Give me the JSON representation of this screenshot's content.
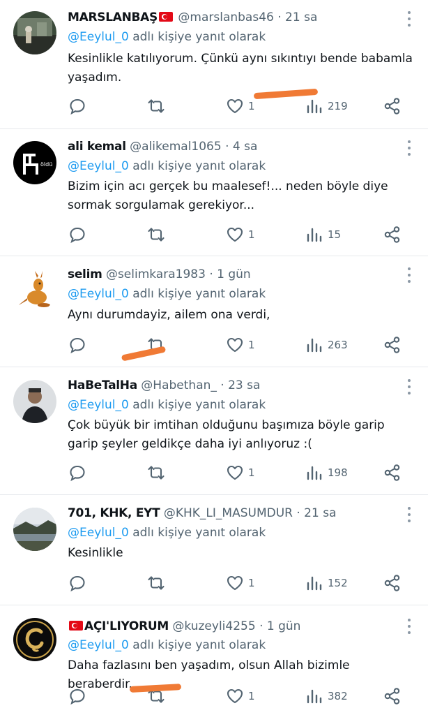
{
  "reply_prefix": "@Eeylul_0",
  "reply_suffix": "adlı kişiye yanıt olarak",
  "tweets": [
    {
      "name": "MARSLANBAŞ",
      "flag_after": true,
      "flag_before": false,
      "handle": "@marslanbas46",
      "time": "21 sa",
      "text": "Kesinlikle katılıyorum. Çünkü aynı sıkıntıyı bende babamla yaşadım.",
      "likes": "1",
      "views": "219",
      "avatar_icon": "landscape-photo-avatar"
    },
    {
      "name": "ali kemal",
      "flag_after": false,
      "flag_before": false,
      "handle": "@alikemal1065",
      "time": "4 sa",
      "text": "Bizim için acı gerçek bu maalesef!... neden böyle diye sormak sorgulamak gerekiyor...",
      "likes": "1",
      "views": "15",
      "avatar_icon": "chair-logo-avatar"
    },
    {
      "name": "selim",
      "flag_after": false,
      "flag_before": false,
      "handle": "@selimkara1983",
      "time": "1 gün",
      "text": "Aynı durumdayiz, ailem ona verdi,",
      "likes": "1",
      "views": "263",
      "avatar_icon": "kangaroo-avatar"
    },
    {
      "name": "HaBeTalHa",
      "flag_after": false,
      "flag_before": false,
      "handle": "@Habethan_",
      "time": "23 sa",
      "text": "Çok büyük bir imtihan olduğunu başımıza böyle garip garip şeyler geldikçe daha iyi anlıyoruz :(",
      "likes": "1",
      "views": "198",
      "avatar_icon": "person-photo-avatar"
    },
    {
      "name": "701, KHK, EYT",
      "flag_after": false,
      "flag_before": false,
      "handle": "@KHK_LI_MASUMDUR",
      "time": "21 sa",
      "text": "Kesinlikle",
      "likes": "1",
      "views": "152",
      "avatar_icon": "river-photo-avatar"
    },
    {
      "name": "AÇI'LIYORUM",
      "flag_after": false,
      "flag_before": true,
      "handle": "@kuzeyli4255",
      "time": "1 gün",
      "text": "Daha fazlasını ben yaşadım, olsun Allah bizimle beraberdir.",
      "likes": "1",
      "views": "382",
      "avatar_icon": "letter-c-logo-avatar"
    }
  ],
  "colors": {
    "accent": "#1d9bf0",
    "muted": "#536471",
    "annotation": "#f07a35",
    "flag": "#e30a17"
  }
}
